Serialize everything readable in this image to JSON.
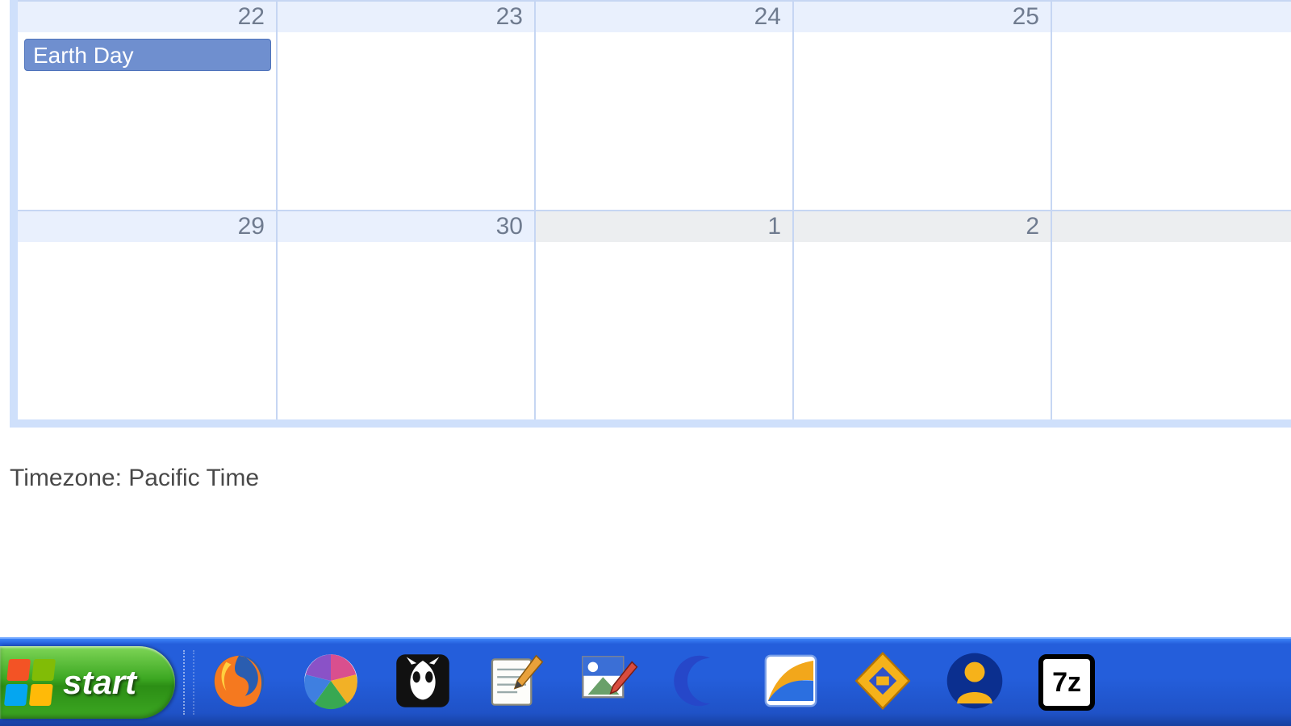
{
  "calendar": {
    "rows": [
      {
        "cells": [
          {
            "date": "22",
            "other_month": false,
            "event": "Earth Day"
          },
          {
            "date": "23",
            "other_month": false
          },
          {
            "date": "24",
            "other_month": false
          },
          {
            "date": "25",
            "other_month": false
          },
          {
            "date": "",
            "other_month": false
          }
        ]
      },
      {
        "cells": [
          {
            "date": "29",
            "other_month": false
          },
          {
            "date": "30",
            "other_month": false
          },
          {
            "date": "1",
            "other_month": true
          },
          {
            "date": "2",
            "other_month": true
          },
          {
            "date": "",
            "other_month": true
          }
        ]
      }
    ]
  },
  "timezone": {
    "label": "Timezone:",
    "value": "Pacific Time"
  },
  "taskbar": {
    "start_label": "start",
    "quicklaunch": [
      {
        "name": "firefox"
      },
      {
        "name": "picasa"
      },
      {
        "name": "foobar2000"
      },
      {
        "name": "notepad"
      },
      {
        "name": "paint"
      },
      {
        "name": "moon"
      },
      {
        "name": "app-orange"
      },
      {
        "name": "hamachi"
      },
      {
        "name": "im-client"
      },
      {
        "name": "7zip",
        "label": "7z"
      }
    ]
  },
  "colors": {
    "grid_line": "#c6d6f3",
    "date_band": "#e9f0fd",
    "date_band_other": "#eceef0",
    "event_bg": "#6f8fcf",
    "calendar_border": "#cfe0fb",
    "taskbar_blue": "#245edb",
    "start_green": "#3ca722"
  }
}
